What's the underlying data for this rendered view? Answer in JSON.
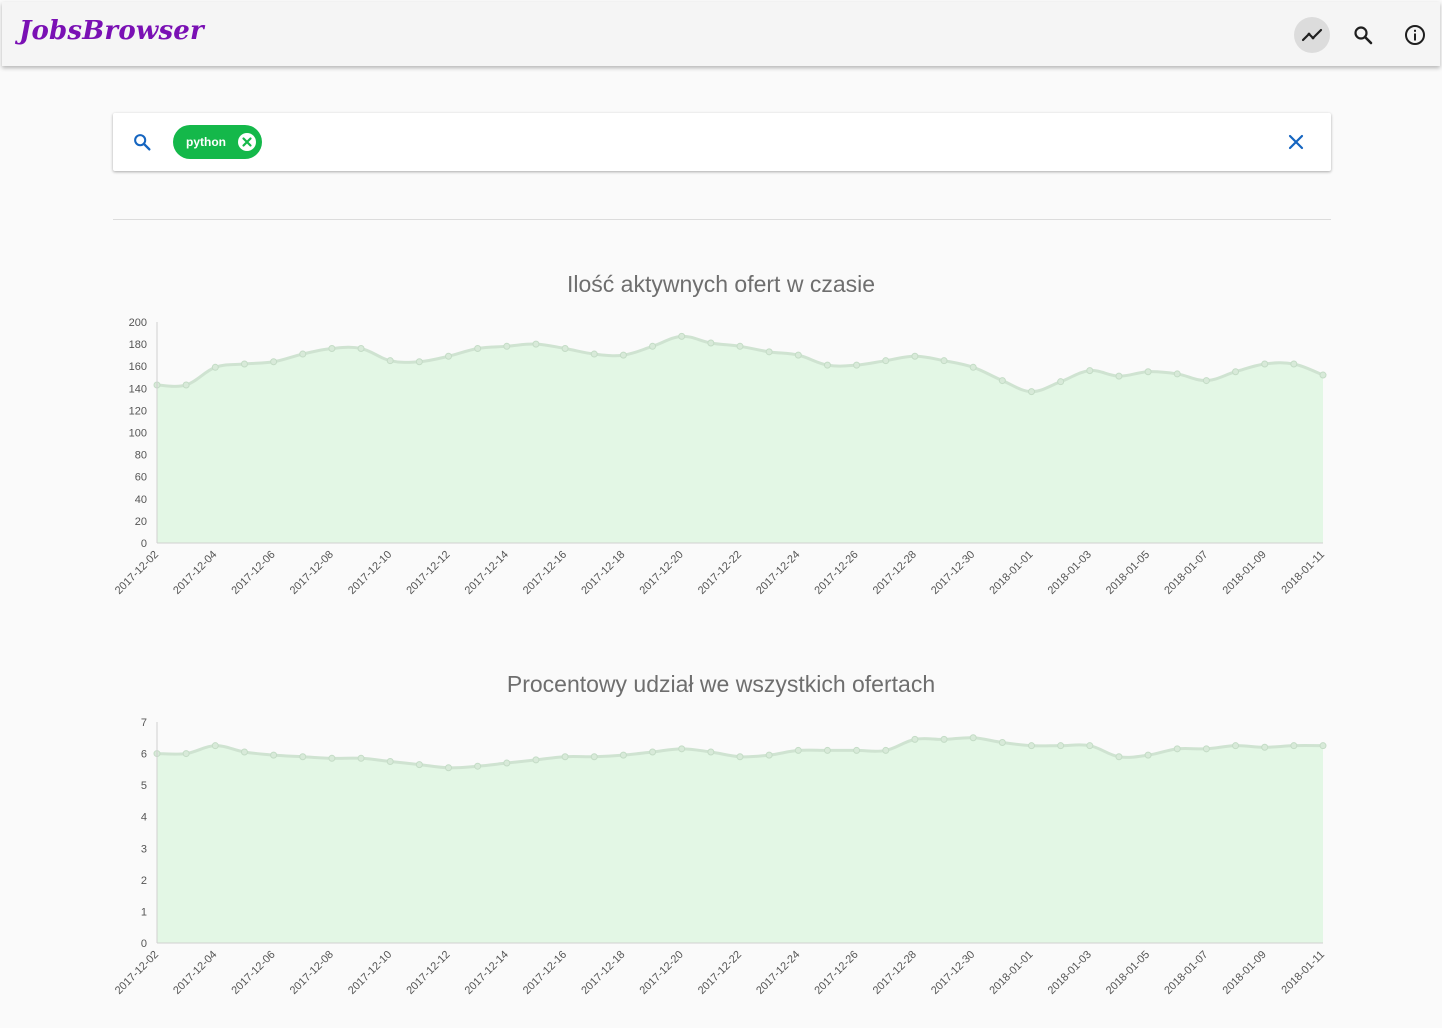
{
  "app": {
    "brand": "JobsBrowser"
  },
  "toolbar": {
    "icons": [
      "trending-up-icon",
      "search-icon",
      "info-icon"
    ]
  },
  "search": {
    "chips": [
      {
        "label": "python"
      }
    ],
    "placeholder": ""
  },
  "colors": {
    "brand": "#7a10b4",
    "chip": "#14b84a",
    "search_accent": "#1565c0",
    "area_fill": "#e3f7e5",
    "line": "#cfe3d1"
  },
  "chart_data": [
    {
      "type": "area",
      "title": "Ilość aktywnych ofert w czasie",
      "xlabel": "",
      "ylabel": "",
      "ylim": [
        0,
        200
      ],
      "yticks": [
        "0",
        "20",
        "40",
        "60",
        "80",
        "100",
        "120",
        "140",
        "160",
        "180",
        "200"
      ],
      "xticks": [
        "2017-12-02",
        "2017-12-04",
        "2017-12-06",
        "2017-12-08",
        "2017-12-10",
        "2017-12-12",
        "2017-12-14",
        "2017-12-16",
        "2017-12-18",
        "2017-12-20",
        "2017-12-22",
        "2017-12-24",
        "2017-12-26",
        "2017-12-28",
        "2017-12-30",
        "2018-01-01",
        "2018-01-03",
        "2018-01-05",
        "2018-01-07",
        "2018-01-09",
        "2018-01-11"
      ],
      "x_start": "2017-12-02",
      "x_end": "2018-01-11",
      "values": [
        143,
        143,
        159,
        162,
        164,
        171,
        176,
        176,
        165,
        164,
        169,
        176,
        178,
        180,
        176,
        171,
        170,
        178,
        187,
        181,
        178,
        173,
        170,
        161,
        161,
        165,
        169,
        165,
        159,
        147,
        137,
        146,
        156,
        151,
        155,
        153,
        147,
        155,
        162,
        162,
        152
      ],
      "grid": false,
      "legend": "none"
    },
    {
      "type": "area",
      "title": "Procentowy udział we wszystkich ofertach",
      "xlabel": "",
      "ylabel": "",
      "ylim": [
        0,
        7
      ],
      "yticks": [
        "0",
        "1",
        "2",
        "3",
        "4",
        "5",
        "6",
        "7"
      ],
      "xticks": [
        "2017-12-02",
        "2017-12-04",
        "2017-12-06",
        "2017-12-08",
        "2017-12-10",
        "2017-12-12",
        "2017-12-14",
        "2017-12-16",
        "2017-12-18",
        "2017-12-20",
        "2017-12-22",
        "2017-12-24",
        "2017-12-26",
        "2017-12-28",
        "2017-12-30",
        "2018-01-01",
        "2018-01-03",
        "2018-01-05",
        "2018-01-07",
        "2018-01-09",
        "2018-01-11"
      ],
      "x_start": "2017-12-02",
      "x_end": "2018-01-11",
      "values": [
        6.0,
        6.0,
        6.25,
        6.05,
        5.95,
        5.9,
        5.85,
        5.85,
        5.75,
        5.65,
        5.55,
        5.6,
        5.7,
        5.8,
        5.9,
        5.9,
        5.95,
        6.05,
        6.15,
        6.05,
        5.9,
        5.95,
        6.1,
        6.1,
        6.1,
        6.1,
        6.45,
        6.45,
        6.5,
        6.35,
        6.25,
        6.25,
        6.25,
        5.9,
        5.95,
        6.15,
        6.15,
        6.25,
        6.2,
        6.25,
        6.25
      ],
      "grid": false,
      "legend": "none"
    }
  ]
}
